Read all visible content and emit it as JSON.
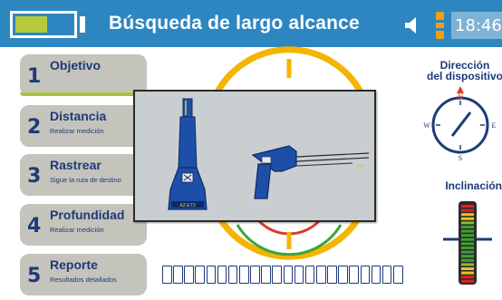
{
  "header": {
    "title": "Búsqueda de largo alcance",
    "time": "18:46",
    "battery_level": 0.5,
    "colors": {
      "bar": "#2e86c1",
      "battery": "#b5c93b",
      "volume": "#f39c12"
    }
  },
  "menu": [
    {
      "number": "1",
      "label": "Objetivo",
      "sub": ""
    },
    {
      "number": "2",
      "label": "Distancia",
      "sub": "Realizar medición"
    },
    {
      "number": "3",
      "label": "Rastrear",
      "sub": "Sigue la ruta de destino"
    },
    {
      "number": "4",
      "label": "Profundidad",
      "sub": "Realizar medición"
    },
    {
      "number": "5",
      "label": "Reporte",
      "sub": "Resultados detallados"
    }
  ],
  "progress": {
    "segments": 22,
    "filled": 0
  },
  "direction": {
    "title_line1": "Dirección",
    "title_line2": "del dispositivo",
    "compass": {
      "n": "N",
      "s": "S",
      "e": "E",
      "w": "W"
    }
  },
  "inclination": {
    "title": "Inclinación"
  },
  "overlay": {
    "device_label": "AZ-ET3"
  }
}
